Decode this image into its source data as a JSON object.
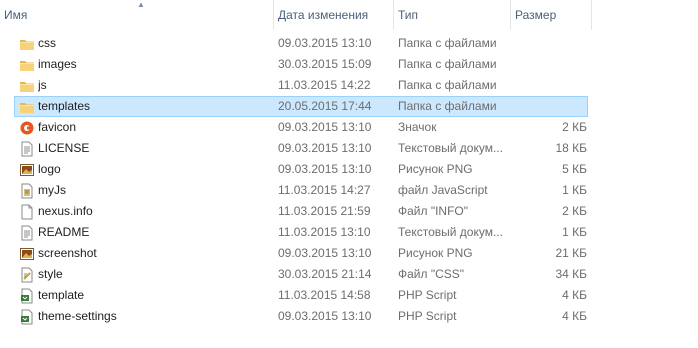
{
  "columns": {
    "name": "Имя",
    "date": "Дата изменения",
    "type": "Тип",
    "size": "Размер"
  },
  "files": [
    {
      "name": "css",
      "date": "09.03.2015 13:10",
      "type": "Папка с файлами",
      "size": "",
      "icon": "folder-icon",
      "selected": false
    },
    {
      "name": "images",
      "date": "30.03.2015 15:09",
      "type": "Папка с файлами",
      "size": "",
      "icon": "folder-icon",
      "selected": false
    },
    {
      "name": "js",
      "date": "11.03.2015 14:22",
      "type": "Папка с файлами",
      "size": "",
      "icon": "folder-icon",
      "selected": false
    },
    {
      "name": "templates",
      "date": "20.05.2015 17:44",
      "type": "Папка с файлами",
      "size": "",
      "icon": "folder-icon",
      "selected": true
    },
    {
      "name": "favicon",
      "date": "09.03.2015 13:10",
      "type": "Значок",
      "size": "2 КБ",
      "icon": "favicon-icon",
      "selected": false
    },
    {
      "name": "LICENSE",
      "date": "09.03.2015 13:10",
      "type": "Текстовый докум...",
      "size": "18 КБ",
      "icon": "text-file-icon",
      "selected": false
    },
    {
      "name": "logo",
      "date": "09.03.2015 13:10",
      "type": "Рисунок PNG",
      "size": "5 КБ",
      "icon": "image-file-icon",
      "selected": false
    },
    {
      "name": "myJs",
      "date": "11.03.2015 14:27",
      "type": "файл JavaScript",
      "size": "1 КБ",
      "icon": "javascript-file-icon",
      "selected": false
    },
    {
      "name": "nexus.info",
      "date": "11.03.2015 21:59",
      "type": "Файл \"INFO\"",
      "size": "2 КБ",
      "icon": "blank-file-icon",
      "selected": false
    },
    {
      "name": "README",
      "date": "11.03.2015 13:10",
      "type": "Текстовый докум...",
      "size": "1 КБ",
      "icon": "text-file-icon",
      "selected": false
    },
    {
      "name": "screenshot",
      "date": "09.03.2015 13:10",
      "type": "Рисунок PNG",
      "size": "21 КБ",
      "icon": "image-file-icon",
      "selected": false
    },
    {
      "name": "style",
      "date": "30.03.2015 21:14",
      "type": "Файл \"CSS\"",
      "size": "34 КБ",
      "icon": "css-file-icon",
      "selected": false
    },
    {
      "name": "template",
      "date": "11.03.2015 14:58",
      "type": "PHP Script",
      "size": "4 КБ",
      "icon": "php-file-icon",
      "selected": false
    },
    {
      "name": "theme-settings",
      "date": "09.03.2015 13:10",
      "type": "PHP Script",
      "size": "4 КБ",
      "icon": "php-file-icon",
      "selected": false
    }
  ],
  "colors": {
    "header_text": "#4c607a",
    "selection_bg": "#cce8ff",
    "selection_border": "#99d1ff",
    "folder": "#f2c55c",
    "secondary_text": "#6d6d6d"
  }
}
